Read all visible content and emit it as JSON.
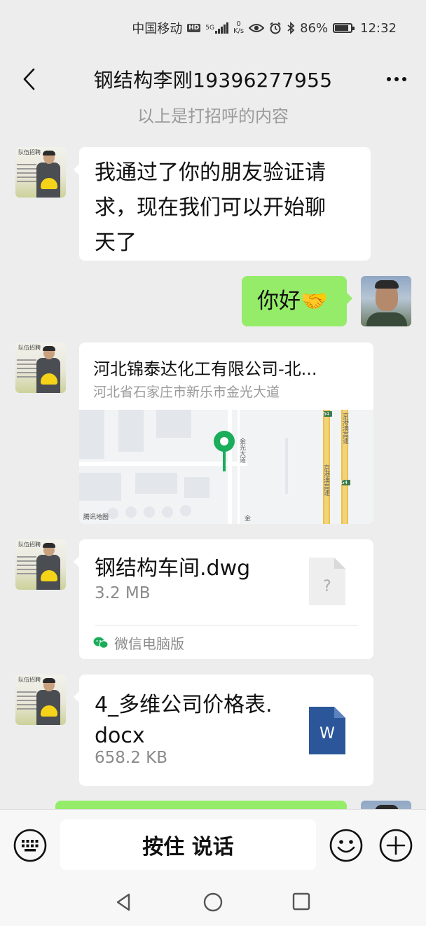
{
  "status_bar": {
    "carrier": "中国移动",
    "hd": "HD",
    "network": "5G",
    "speed_value": "0",
    "speed_unit": "K/s",
    "battery": "86%",
    "battery_level": 0.86,
    "time": "12:32"
  },
  "header": {
    "title": "钢结构李刚19396277955"
  },
  "system_message": "以上是打招呼的内容",
  "messages": {
    "m1": {
      "text": "我通过了你的朋友验证请\n求，现在我们可以开始聊\n天了"
    },
    "m2": {
      "text": "你好🤝"
    },
    "m3": {
      "title": "河北锦泰达化工有限公司-北...",
      "address": "河北省石家庄市新乐市金光大道",
      "map_labels": {
        "road_golden": "金光大道",
        "highway_top": "G4",
        "highway_top_name": "京港澳高速",
        "highway_mid": "G4",
        "highway_name": "京港澳高速",
        "bottom_label": "金",
        "credit": "腾讯地图"
      }
    },
    "m4": {
      "file_name": "钢结构车间.dwg",
      "file_size": "3.2 MB",
      "source": "微信电脑版"
    },
    "m5": {
      "file_name": "4_多维公司价格表.\ndocx",
      "file_size": "658.2 KB",
      "file_type_letter": "W"
    }
  },
  "recruit_avatar_tag": "队伍招聘",
  "input_bar": {
    "voice_label": "按住 说话"
  },
  "colors": {
    "background": "#ededed",
    "self_bubble": "#95ec69",
    "other_bubble": "#ffffff",
    "map_pin": "#1aad5a",
    "word_icon": "#2b579a"
  },
  "icons": [
    "back-arrow-icon",
    "more-dots-icon",
    "keyboard-icon",
    "emoji-icon",
    "plus-icon",
    "nav-back-icon",
    "nav-home-icon",
    "nav-recent-icon",
    "map-pin-icon",
    "unknown-file-icon",
    "word-file-icon",
    "wechat-pc-icon"
  ]
}
